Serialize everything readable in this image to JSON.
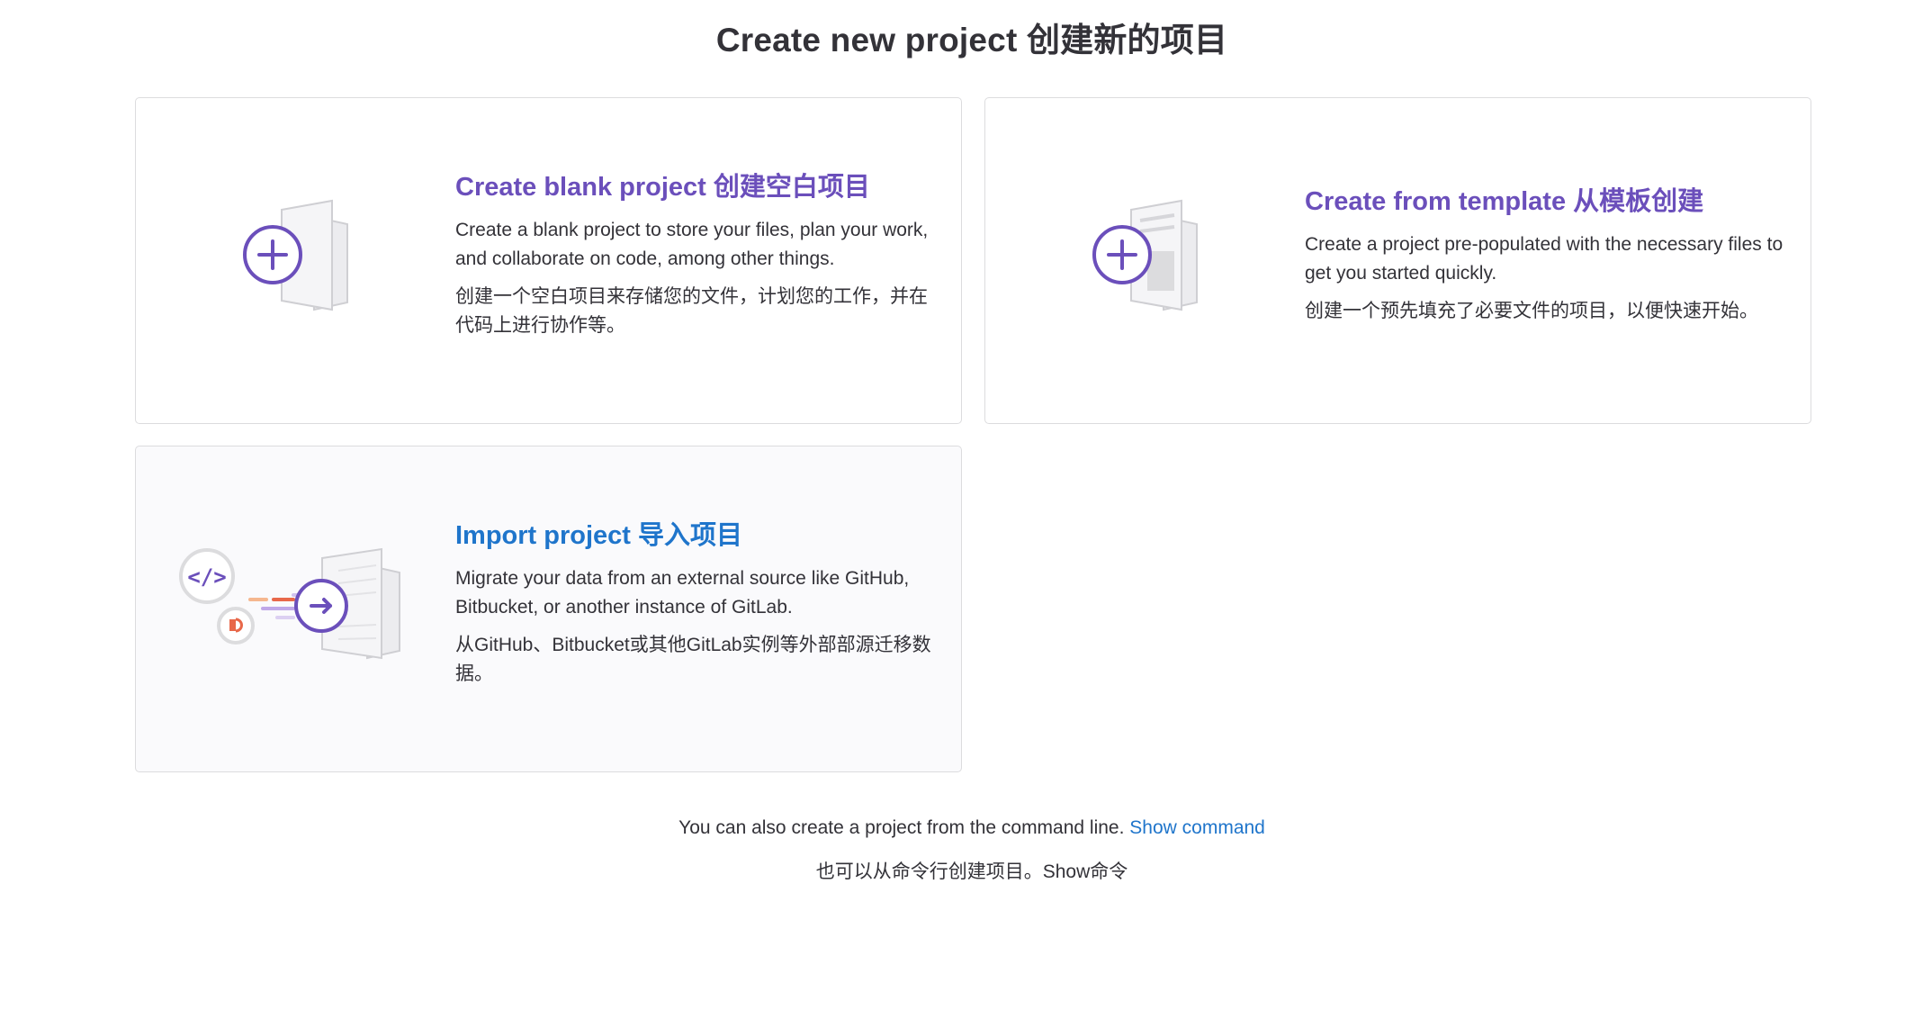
{
  "page": {
    "title": "Create new project  创建新的项目"
  },
  "cards": {
    "blank": {
      "title": "Create blank project  创建空白项目",
      "description": "Create a blank project to store your files, plan your work, and collaborate on code, among other things.",
      "description_zh": "创建一个空白项目来存储您的文件，计划您的工作，并在代码上进行协作等。",
      "icon": "blank-project-illustration"
    },
    "template": {
      "title": "Create from template  从模板创建",
      "description": "Create a project pre-populated with the necessary files to get you started quickly.",
      "description_zh": "创建一个预先填充了必要文件的项目，以便快速开始。",
      "icon": "template-project-illustration"
    },
    "import": {
      "title": "Import project  导入项目",
      "description": "Migrate your data from an external source like GitHub, Bitbucket, or another instance of GitLab.",
      "description_zh": "从GitHub、Bitbucket或其他GitLab实例等外部部源迁移数据。",
      "icon": "import-project-illustration"
    }
  },
  "footer": {
    "text": "You can also create a project from the command line.",
    "link_label": "Show command",
    "text_zh": "也可以从命令行创建项目。Show命令"
  },
  "colors": {
    "purple": "#6b4fbb",
    "blue": "#1f75cb",
    "orange": "#e24329",
    "text": "#333238",
    "border": "#dcdcde"
  }
}
